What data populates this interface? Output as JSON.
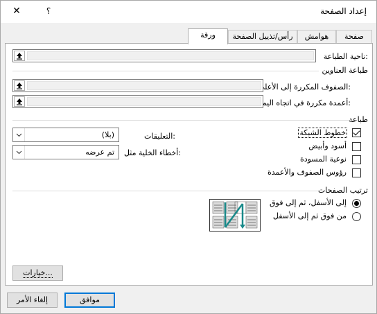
{
  "title": "إعداد الصفحة",
  "help_label": "؟",
  "close_label": "✕",
  "tabs": [
    "صفحة",
    "هوامش",
    "رأس/تذييل الصفحة",
    "ورقة"
  ],
  "print_area_label": "ناحية الطباعة:",
  "print_titles": {
    "heading": "طباعة العناوين",
    "rows_label": "الصفوف المكررة إلى الأعلى:",
    "cols_label": "أعمدة مكررة في اتجاه اليمين:"
  },
  "print": {
    "heading": "طباعة",
    "gridlines": "خطوط الشبكة",
    "black_white": "أسود وأبيض",
    "draft": "نوعية المسودة",
    "headings": "رؤوس الصفوف والأعمدة",
    "comments_label": "التعليقات:",
    "comments_value": "(بلا)",
    "errors_label": "أخطاء الخلية مثل:",
    "errors_value": "تم عرضه",
    "gridlines_checked": true,
    "black_white_checked": false,
    "draft_checked": false,
    "headings_checked": false
  },
  "page_order": {
    "heading": "ترتيب الصفحات",
    "down_then_over": "إلى الأسفل، ثم إلى فوق",
    "over_then_down": "من فوق ثم إلى الأسفل",
    "selected": "down_then_over"
  },
  "options_button": "خيارات...",
  "ok_button": "موافق",
  "cancel_button": "إلغاء الأمر",
  "colors": {
    "accent": "#0078d7",
    "diagram_arrow": "#1a8a8a"
  }
}
